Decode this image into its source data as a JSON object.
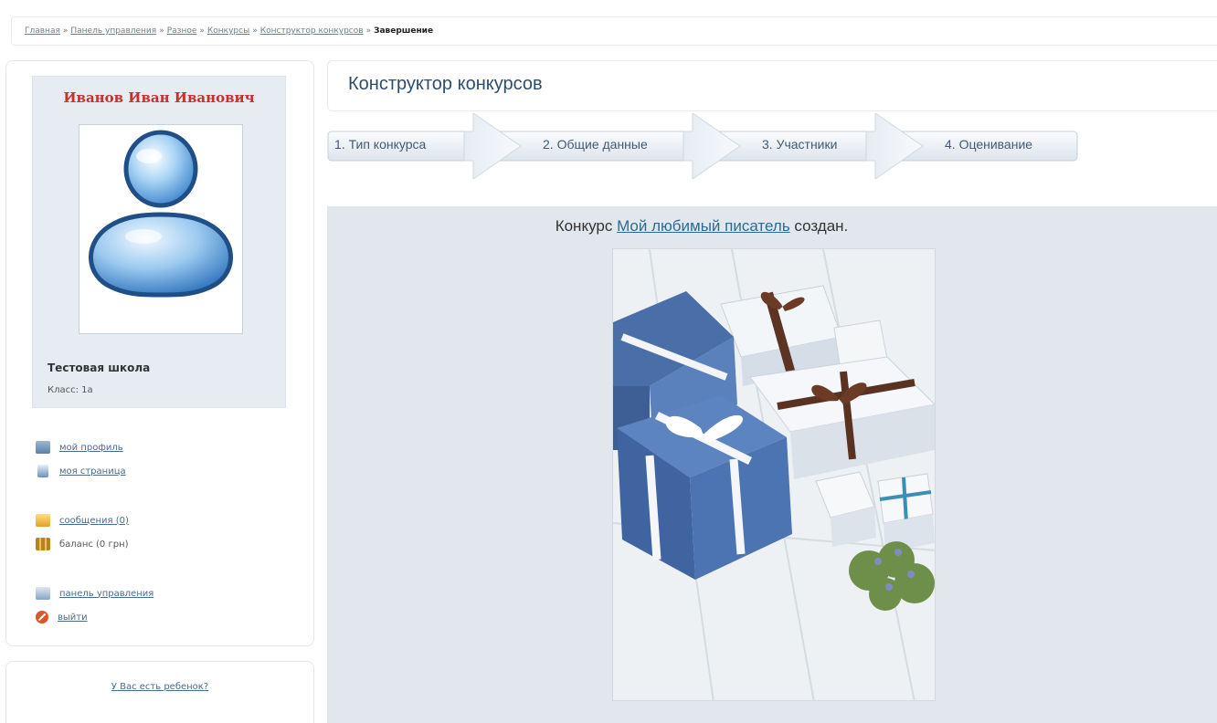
{
  "breadcrumb": {
    "items": [
      "Главная",
      "Панель управления",
      "Разное",
      "Конкурсы",
      "Конструктор конкурсов"
    ],
    "separator": "»",
    "current": "Завершение"
  },
  "profile": {
    "name": "Иванов Иван Иванович",
    "school": "Тестовая школа",
    "class_line": "Класс: 1а",
    "avatar_icon": "user-avatar-icon"
  },
  "menu": {
    "profile": "мой профиль",
    "page": "моя страница",
    "messages": "сообщения (0)",
    "balance": "баланс (0 грн)",
    "control_panel": "панель управления",
    "logout": "выйти"
  },
  "child_panel": {
    "link": "У Вас есть ребенок?"
  },
  "main": {
    "title": "Конструктор конкурсов",
    "steps": [
      "1. Тип конкурса",
      "2. Общие данные",
      "3. Участники",
      "4. Оценивание"
    ],
    "result": {
      "prefix": "Конкурс",
      "contest_name": "Мой любимый писатель",
      "suffix": "создан."
    }
  },
  "colors": {
    "accent_name": "#c9302c",
    "link": "#2d6a92",
    "content_bg": "#e2e7ee",
    "step_text": "#3f5a75"
  }
}
